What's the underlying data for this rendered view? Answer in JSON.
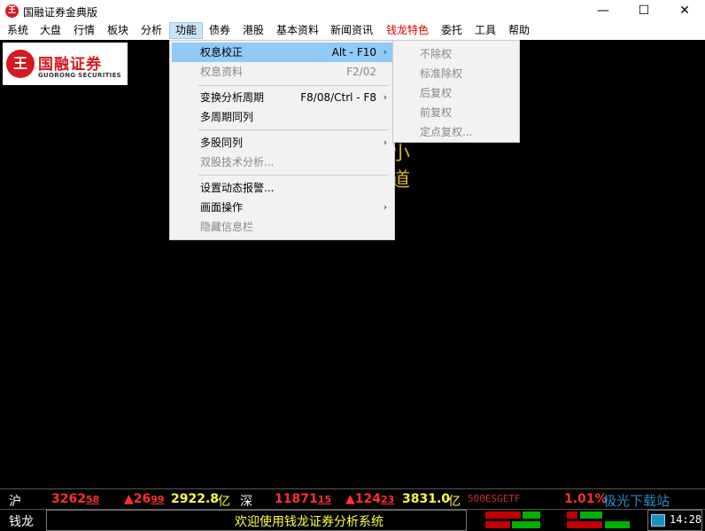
{
  "window": {
    "title": "国融证券金典版",
    "icon_glyph": "王",
    "minimize": "—",
    "maximize": "☐",
    "close": "✕"
  },
  "menubar": [
    {
      "label": "系统"
    },
    {
      "label": "大盘"
    },
    {
      "label": "行情"
    },
    {
      "label": "板块"
    },
    {
      "label": "分析"
    },
    {
      "label": "功能"
    },
    {
      "label": "债券"
    },
    {
      "label": "港股"
    },
    {
      "label": "基本资料"
    },
    {
      "label": "新闻资讯"
    },
    {
      "label": "钱龙特色"
    },
    {
      "label": "委托"
    },
    {
      "label": "工具"
    },
    {
      "label": "帮助"
    }
  ],
  "logo": {
    "cn": "国融证券",
    "en": "GUORONG SECURITIES",
    "glyph": "王"
  },
  "background_text": [
    "小",
    "道"
  ],
  "function_menu": [
    {
      "label": "权息校正",
      "shortcut": "Alt - F10",
      "arrow": "›",
      "disabled": false,
      "hover": true
    },
    {
      "label": "权息资料",
      "shortcut": "F2/02",
      "disabled": true
    },
    {
      "label": "变换分析周期",
      "shortcut": "F8/08/Ctrl - F8",
      "arrow": "›",
      "disabled": false
    },
    {
      "label": "多周期同列",
      "disabled": false
    },
    {
      "label": "多股同列",
      "arrow": "›",
      "disabled": false
    },
    {
      "label": "双股技术分析...",
      "disabled": true
    },
    {
      "label": "设置动态报警...",
      "disabled": false
    },
    {
      "label": "画面操作",
      "arrow": "›",
      "disabled": false
    },
    {
      "label": "隐藏信息栏",
      "disabled": true
    }
  ],
  "submenu": [
    {
      "label": "不除权"
    },
    {
      "label": "标准除权"
    },
    {
      "label": "后复权"
    },
    {
      "label": "前复权"
    },
    {
      "label": "定点复权..."
    }
  ],
  "status_bar": {
    "sh_label": "沪",
    "sh_index_main": "3262",
    "sh_index_dec": "58",
    "sh_change_main": "▲26",
    "sh_change_dec": "99",
    "sh_volume": "2922.8",
    "sh_unit": "亿",
    "sz_label": "深",
    "sz_index_main": "11871",
    "sz_index_dec": "15",
    "sz_change_main": "▲124",
    "sz_change_dec": "23",
    "sz_volume": "3831.0",
    "sz_unit": "亿",
    "etf_name": "500ESGETF",
    "etf_change": "1.01%",
    "app_name": "钱龙",
    "welcome": "欢迎使用钱龙证券分析系统",
    "time": "14:28",
    "watermark": "极光下载站"
  },
  "colors": {
    "red": "#ff3030",
    "yellow": "#ffff40",
    "hover": "#91c9f7",
    "menu_active": "#cce4f7",
    "brand": "#d7191f"
  }
}
